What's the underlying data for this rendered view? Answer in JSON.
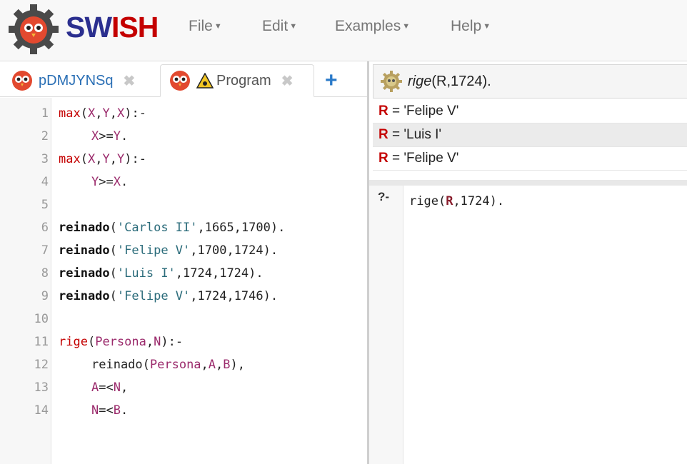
{
  "navbar": {
    "brand_sw": "SW",
    "brand_ish": "ISH",
    "menus": [
      "File",
      "Edit",
      "Examples",
      "Help"
    ]
  },
  "tabs": [
    {
      "label": "pDMJYNSq",
      "close": "✖"
    },
    {
      "label": "Program",
      "close": "✖"
    }
  ],
  "new_tab": "+",
  "editor": {
    "lines": [
      {
        "n": "1"
      },
      {
        "n": "2"
      },
      {
        "n": "3"
      },
      {
        "n": "4"
      },
      {
        "n": "5"
      },
      {
        "n": "6"
      },
      {
        "n": "7"
      },
      {
        "n": "8"
      },
      {
        "n": "9"
      },
      {
        "n": "10"
      },
      {
        "n": "11"
      },
      {
        "n": "12"
      },
      {
        "n": "13"
      },
      {
        "n": "14"
      }
    ]
  },
  "code": {
    "l1": [
      "max",
      "(",
      "X",
      ",",
      "Y",
      ",",
      "X",
      "):-"
    ],
    "l2": [
      "X",
      ">=",
      "Y",
      "."
    ],
    "l3": [
      "max",
      "(",
      "X",
      ",",
      "Y",
      ",",
      "Y",
      "):-"
    ],
    "l4": [
      "Y",
      ">=",
      "X",
      "."
    ],
    "l6": [
      "reinado",
      "(",
      "'Carlos II'",
      ",1665,1700)."
    ],
    "l7": [
      "reinado",
      "(",
      "'Felipe V'",
      ",1700,1724)."
    ],
    "l8": [
      "reinado",
      "(",
      "'Luis I'",
      ",1724,1724)."
    ],
    "l9": [
      "reinado",
      "(",
      "'Felipe V'",
      ",1724,1746)."
    ],
    "l11": [
      "rige",
      "(",
      "Persona",
      ",",
      "N",
      "):-"
    ],
    "l12": [
      "reinado(",
      "Persona",
      ",",
      "A",
      ",",
      "B",
      "),"
    ],
    "l13": [
      "A",
      "=<",
      "N",
      ","
    ],
    "l14": [
      "N",
      "=<",
      "B",
      "."
    ]
  },
  "results": {
    "query_name": "rige",
    "query_args": "(R,1724).",
    "answers": [
      {
        "var": "R",
        "eq": " = ",
        "val": "'Felipe V'"
      },
      {
        "var": "R",
        "eq": " = ",
        "val": "'Luis I'"
      },
      {
        "var": "R",
        "eq": " = ",
        "val": "'Felipe V'"
      }
    ]
  },
  "console": {
    "prompt": "?-",
    "query_pre": "rige(",
    "query_var": "R",
    "query_post": ",1724)."
  },
  "colors": {
    "accent_blue": "#2a6fb5",
    "brand_red": "#c40000",
    "brand_navy": "#2b2f8f"
  }
}
